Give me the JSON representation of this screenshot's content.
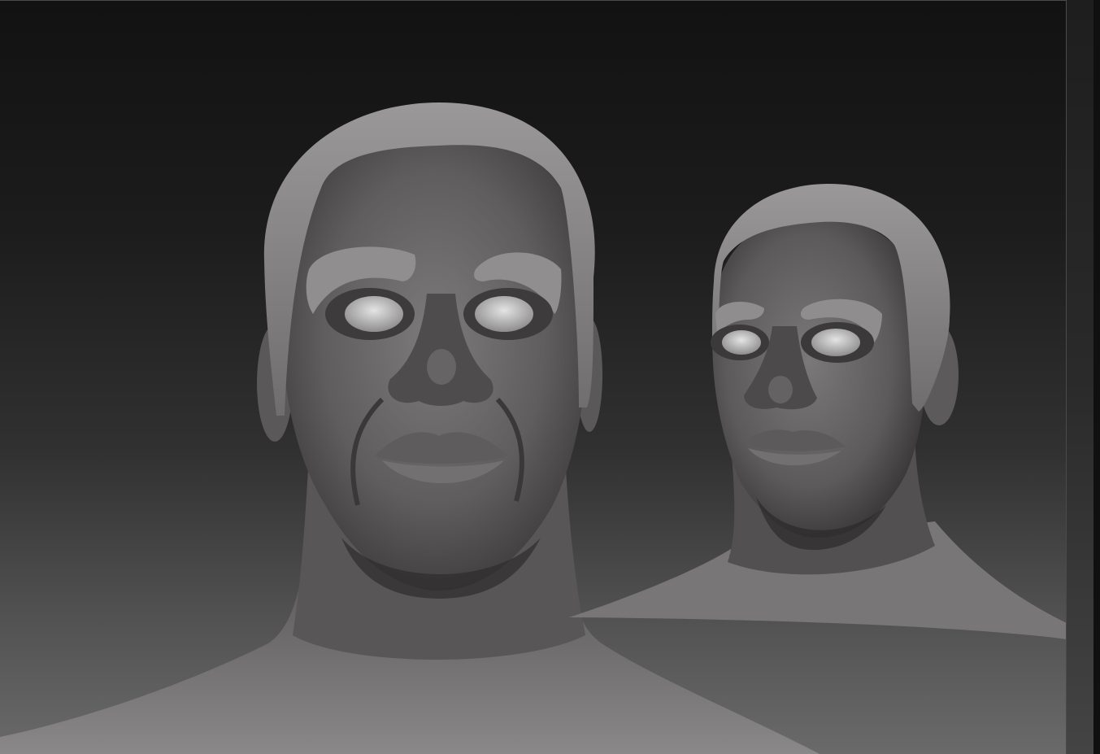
{
  "app": {
    "type": "3d-sculpting-viewport"
  },
  "viewport": {
    "background_top": "#121212",
    "background_bottom": "#6a6a6a",
    "clay_color": "#6b6969",
    "clay_highlight": "#a9a7a7",
    "clay_shadow": "#2a2828"
  },
  "models": [
    {
      "name": "head-bust-front",
      "view": "front"
    },
    {
      "name": "head-bust-three-quarter",
      "view": "three-quarter"
    }
  ]
}
